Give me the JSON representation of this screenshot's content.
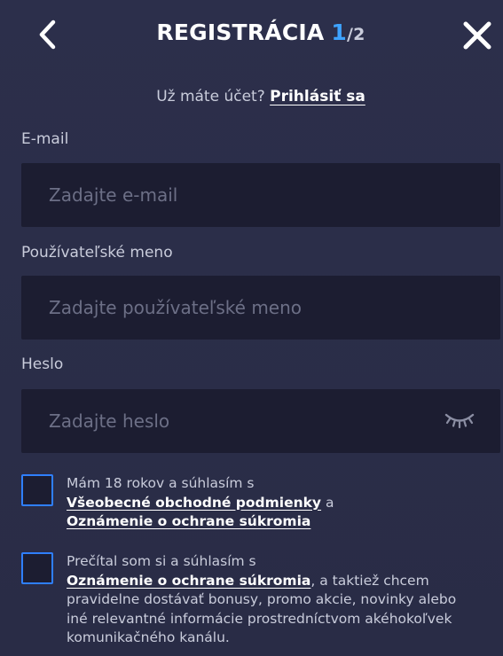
{
  "header": {
    "title": "REGISTRÁCIA",
    "step": "1",
    "total": "/2"
  },
  "login": {
    "prompt": "Už máte účet?",
    "link": "Prihlásiť sa"
  },
  "fields": {
    "email": {
      "label": "E-mail",
      "placeholder": "Zadajte e-mail",
      "value": ""
    },
    "username": {
      "label": "Používateľské meno",
      "placeholder": "Zadajte používateľské meno",
      "value": ""
    },
    "password": {
      "label": "Heslo",
      "placeholder": "Zadajte heslo",
      "value": ""
    }
  },
  "consents": {
    "age": {
      "checked": false,
      "text_1": "Mám 18 rokov a súhlasím s",
      "link_terms": "Všeobecné obchodné podmienky",
      "text_2": " a",
      "link_privacy": "Oznámenie o ochrane súkromia"
    },
    "marketing": {
      "checked": false,
      "text_1": "Prečítal som si a súhlasím s",
      "link_privacy": "Oznámenie o ochrane súkromia",
      "text_2": ", a taktiež chcem pravidelne dostávať bonusy, promo akcie, novinky alebo iné relevantné informácie prostredníctvom akéhokoľvek komunikačného kanálu."
    }
  },
  "icons": {
    "back": "chevron-left-icon",
    "close": "close-icon",
    "password_toggle": "eye-closed-icon"
  },
  "colors": {
    "background": "#2a2d47",
    "input_bg": "#1c1d31",
    "accent": "#3ea3ff",
    "checkbox_border": "#2f7fff",
    "text": "#c9ccdb",
    "placeholder": "#6c6f86"
  }
}
